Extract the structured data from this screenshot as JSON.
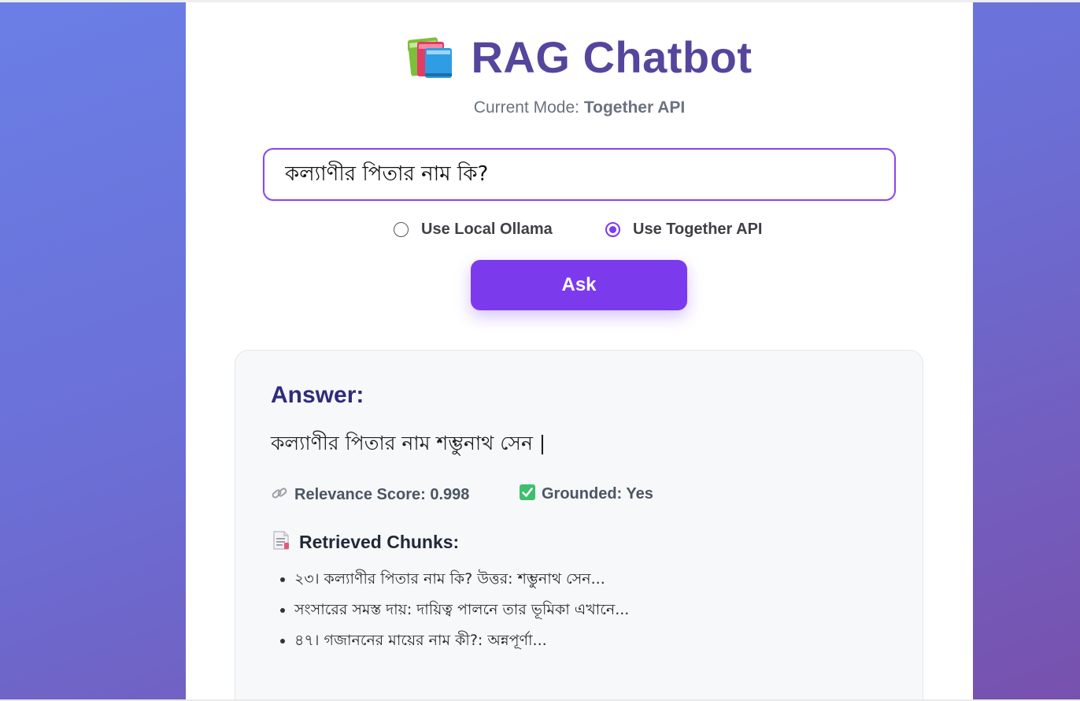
{
  "app": {
    "title": "RAG Chatbot",
    "mode_label": "Current Mode:",
    "mode_value": "Together API"
  },
  "query": {
    "value": "কল্যাণীর পিতার নাম কি?",
    "placeholder": ""
  },
  "options": {
    "local_label": "Use Local Ollama",
    "together_label": "Use Together API",
    "selected": "Together API"
  },
  "ask_button": {
    "label": "Ask"
  },
  "answer": {
    "heading": "Answer:",
    "text": "কল্যাণীর পিতার নাম শম্ভুনাথ সেন |",
    "relevance": "Relevance Score: 0.998",
    "grounded": "Grounded: Yes"
  },
  "chunks": {
    "heading": "Retrieved Chunks:",
    "items": [
      "২৩। কল্যাণীর পিতার নাম কি? উত্তর: শম্ভুনাথ সেন...",
      "সংসারের সমস্ত দায়: দায়িত্ব পালনে তার ভূমিকা এখানে...",
      "৪৭। গজাননের মায়ের নাম কী?: অন্নপূর্ণা..."
    ]
  },
  "icons": {
    "title": "books-icon",
    "relevance": "link-icon",
    "grounded": "check-mark-icon",
    "chunks": "document-icon"
  },
  "colors": {
    "accent": "#7c3aed",
    "title": "#56459c",
    "answer_heading": "#2e2b7c",
    "background_start": "#6a7fe6",
    "background_end": "#7851ad"
  }
}
